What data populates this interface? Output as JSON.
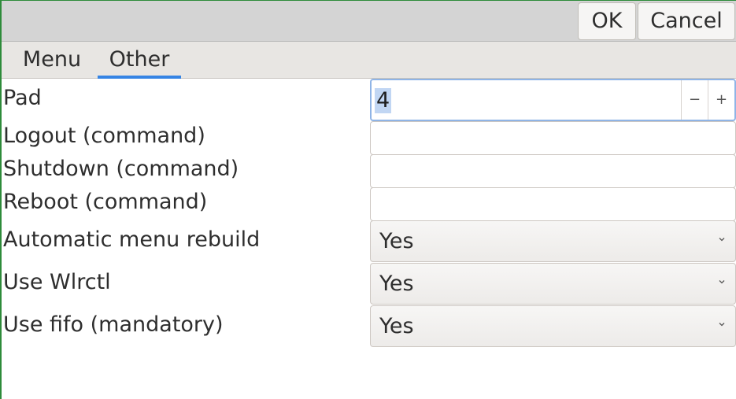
{
  "header": {
    "ok_label": "OK",
    "cancel_label": "Cancel"
  },
  "tabs": [
    {
      "label": "Menu",
      "active": false
    },
    {
      "label": "Other",
      "active": true
    }
  ],
  "settings": {
    "pad": {
      "label": "Pad",
      "value": "4"
    },
    "logout": {
      "label": "Logout (command)",
      "value": ""
    },
    "shutdown": {
      "label": "Shutdown (command)",
      "value": ""
    },
    "reboot": {
      "label": "Reboot (command)",
      "value": ""
    },
    "menu_rebuild": {
      "label": "Automatic menu rebuild",
      "value": "Yes"
    },
    "wlrctl": {
      "label": "Use Wlrctl",
      "value": "Yes"
    },
    "fifo": {
      "label": "Use fifo (mandatory)",
      "value": "Yes"
    }
  },
  "icons": {
    "minus": "−",
    "plus": "+",
    "chevron": "chevron-down-icon"
  },
  "colors": {
    "accent": "#3584e4",
    "selection": "#c1d6f3",
    "headerbar": "#d4d4d4",
    "window_border": "#2e8b3a"
  }
}
